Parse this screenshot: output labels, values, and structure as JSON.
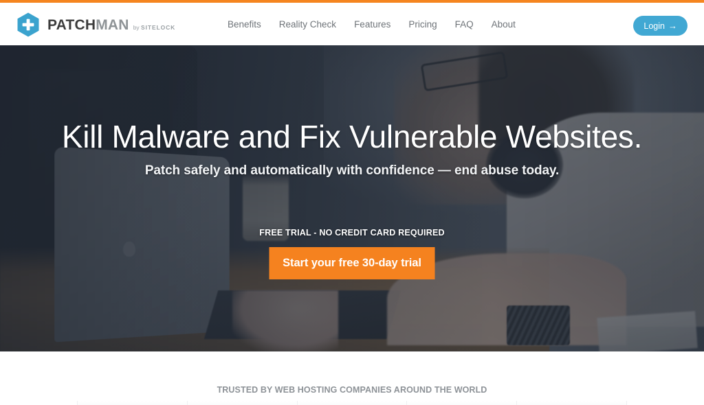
{
  "brand": {
    "logo_icon": "hexagon-plus-icon",
    "name_first": "PATCH",
    "name_second": "MAN",
    "tagline_prefix": "by ",
    "tagline_name": "SITELOCK",
    "accent_blue": "#41a8d3",
    "accent_orange": "#f5821f"
  },
  "header": {
    "nav": [
      {
        "label": "Benefits"
      },
      {
        "label": "Reality Check"
      },
      {
        "label": "Features"
      },
      {
        "label": "Pricing"
      },
      {
        "label": "FAQ"
      },
      {
        "label": "About"
      }
    ],
    "login": {
      "label": "Login",
      "arrow": "→",
      "icon": "arrow-right-icon"
    }
  },
  "hero": {
    "title": "Kill Malware and Fix Vulnerable Websites.",
    "subtitle": "Patch safely and automatically with confidence — end abuse today.",
    "eyebrow": "FREE TRIAL - NO CREDIT CARD REQUIRED",
    "cta_label": "Start your free 30-day trial",
    "background_description": "man-with-glasses-and-headphones-working-on-laptop"
  },
  "trusted": {
    "title": "TRUSTED BY WEB HOSTING COMPANIES AROUND THE WORLD",
    "logo_slots": [
      "",
      "",
      "",
      "",
      ""
    ]
  }
}
